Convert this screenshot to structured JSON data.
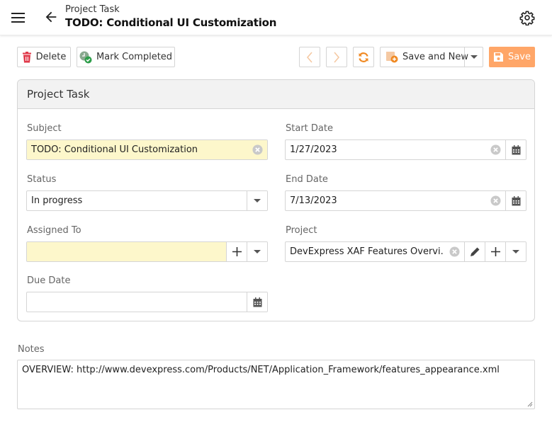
{
  "header": {
    "subtitle": "Project Task",
    "title": "TODO: Conditional UI Customization",
    "icons": {
      "menu": "hamburger-icon",
      "back": "arrow-left-icon",
      "settings": "gear-icon"
    }
  },
  "toolbar": {
    "delete_label": "Delete",
    "mark_completed_label": "Mark Completed",
    "save_and_new_label": "Save and New",
    "save_label": "Save",
    "icons": {
      "delete": "trash-icon",
      "mark_completed": "task-check-icon",
      "previous": "chevron-left-icon",
      "next": "chevron-right-icon",
      "refresh": "refresh-icon",
      "save_and_new": "save-new-icon",
      "save": "floppy-disk-icon"
    }
  },
  "group": {
    "title": "Project Task",
    "fields": {
      "subject": {
        "label": "Subject",
        "value": "TODO: Conditional UI Customization"
      },
      "status": {
        "label": "Status",
        "value": "In progress"
      },
      "assigned_to": {
        "label": "Assigned To",
        "value": ""
      },
      "due_date": {
        "label": "Due Date",
        "value": ""
      },
      "start_date": {
        "label": "Start Date",
        "value": "1/27/2023"
      },
      "end_date": {
        "label": "End Date",
        "value": "7/13/2023"
      },
      "project": {
        "label": "Project",
        "value": "DevExpress XAF Features Overvi..."
      }
    }
  },
  "notes": {
    "label": "Notes",
    "value": "OVERVIEW: http://www.devexpress.com/Products/NET/Application_Framework/features_appearance.xml"
  },
  "colors": {
    "accent": "#ffa668",
    "accent_icon": "#f08a24",
    "required_field_bg": "#fdf7cb",
    "delete_icon": "#e0394a",
    "complete_icon": "#2e9e4a"
  }
}
